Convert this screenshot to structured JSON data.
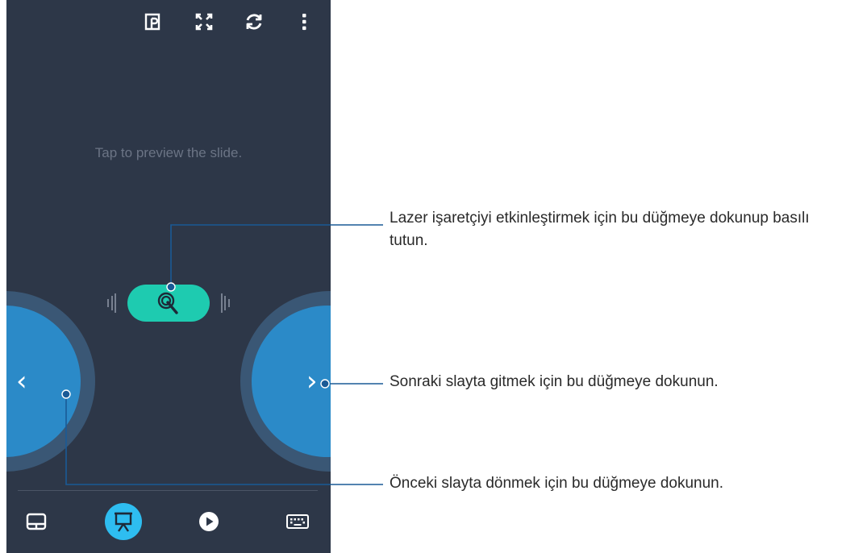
{
  "phone": {
    "preview_hint": "Tap to preview the slide.",
    "prev_chevron": "‹",
    "next_chevron": "›"
  },
  "topbar": {
    "icons": [
      "presentation-file-icon",
      "fullscreen-icon",
      "refresh-icon",
      "more-vert-icon"
    ]
  },
  "bottombar": {
    "icons": [
      "touchpad-icon",
      "presenter-icon",
      "play-icon",
      "keyboard-icon"
    ],
    "active": "presenter-icon"
  },
  "callouts": {
    "laser": "Lazer işaretçiyi etkinleştirmek için bu düğmeye dokunup basılı tutun.",
    "next": "Sonraki slayta gitmek için bu düğmeye dokunun.",
    "prev": "Önceki slayta dönmek için bu düğmeye dokunun."
  },
  "colors": {
    "phone_bg": "#2d3748",
    "laser_button": "#1ecbb0",
    "nav_button": "#2b8ac8",
    "active_tab": "#2ebdf0",
    "callout_line": "#1a5a96"
  }
}
